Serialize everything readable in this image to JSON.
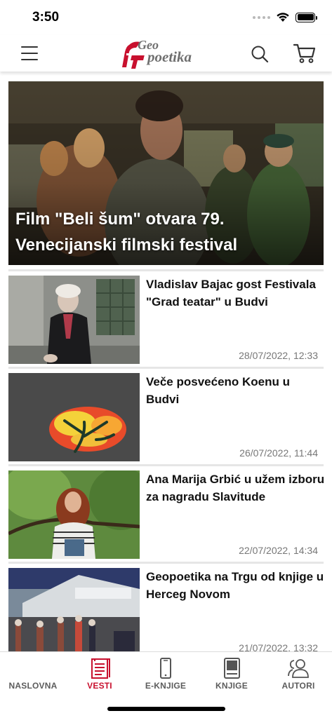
{
  "status_bar": {
    "time": "3:50"
  },
  "header": {
    "logo_line1": "Geo",
    "logo_line2": "poetika",
    "menu_icon": "hamburger-menu-icon",
    "search_icon": "search-icon",
    "cart_icon": "shopping-cart-icon"
  },
  "featured": {
    "title": "Film \"Beli šum\" otvara 79. Venecijanski filmski festival"
  },
  "news": [
    {
      "title": "Vladislav Bajac gost Festivala \"Grad teatar\" u Budvi",
      "date": "28/07/2022, 12:33"
    },
    {
      "title": "Veče posvećeno Koenu u Budvi",
      "date": "26/07/2022, 11:44"
    },
    {
      "title": "Ana Marija Grbić u užem izboru za nagradu Slavitude",
      "date": "22/07/2022, 14:34"
    },
    {
      "title": "Geopoetika na Trgu od knjige u Herceg Novom",
      "date": "21/07/2022, 13:32"
    }
  ],
  "tabs": [
    {
      "label": "NASLOVNA",
      "icon": "home-icon",
      "active": false
    },
    {
      "label": "VESTI",
      "icon": "news-icon",
      "active": true
    },
    {
      "label": "E-KNJIGE",
      "icon": "phone-icon",
      "active": false
    },
    {
      "label": "KNJIGE",
      "icon": "book-icon",
      "active": false
    },
    {
      "label": "AUTORI",
      "icon": "users-icon",
      "active": false
    }
  ],
  "colors": {
    "accent": "#c8102e",
    "tab_inactive": "#5c5c5c",
    "date": "#777777"
  }
}
